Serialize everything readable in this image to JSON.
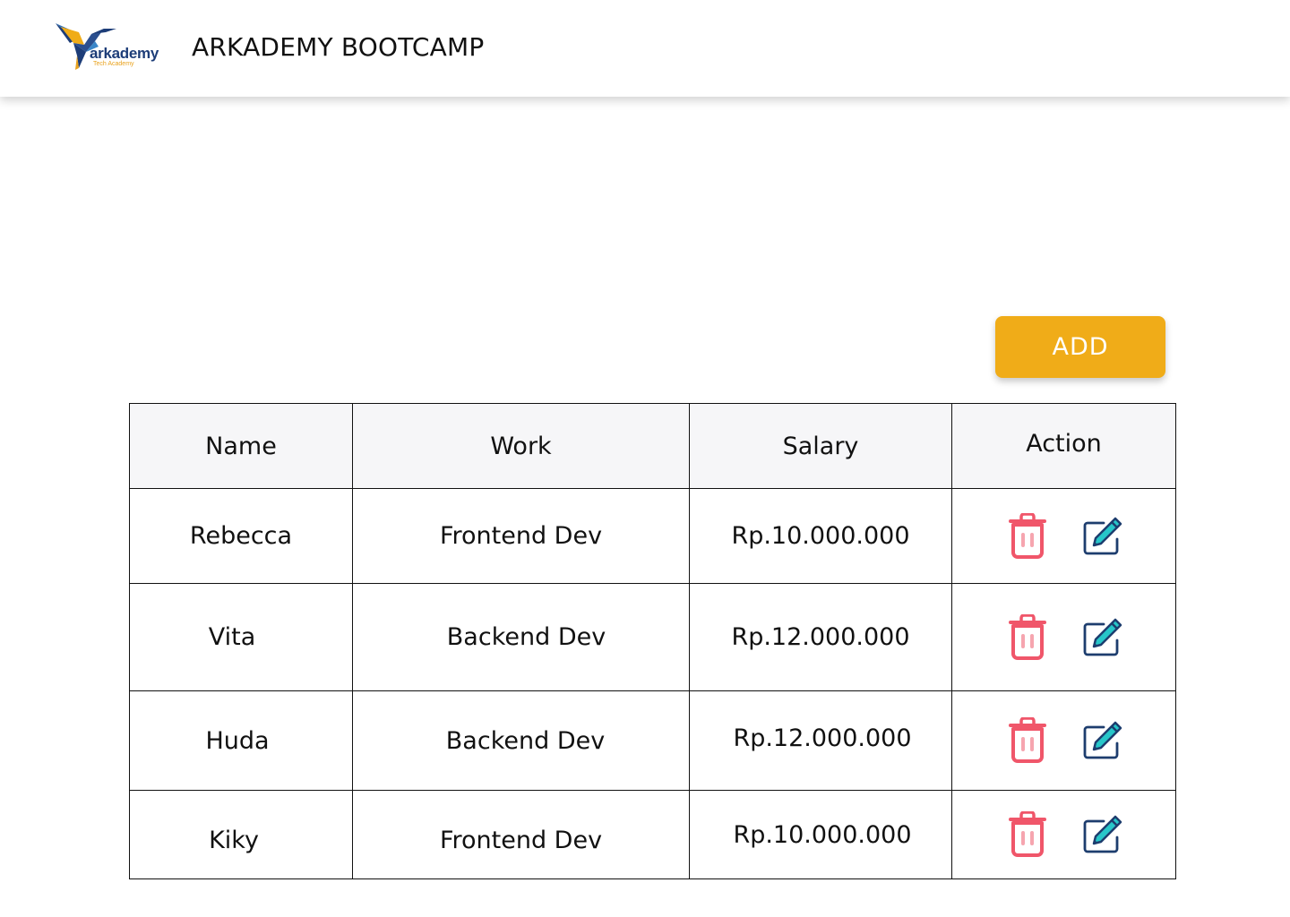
{
  "header": {
    "logo": {
      "icon": "hummingbird-logo-icon",
      "word": "arkademy",
      "sub": "Tech Academy"
    },
    "title": "ARKADEMY BOOTCAMP"
  },
  "toolbar": {
    "add_label": "ADD"
  },
  "table": {
    "headers": {
      "name": "Name",
      "work": "Work",
      "salary": "Salary",
      "action": "Action"
    },
    "rows": [
      {
        "name": "Rebecca",
        "work": "Frontend Dev",
        "salary": "Rp.10.000.000"
      },
      {
        "name": "Vita",
        "work": "Backend Dev",
        "salary": "Rp.12.000.000"
      },
      {
        "name": "Huda",
        "work": "Backend Dev",
        "salary": "Rp.12.000.000"
      },
      {
        "name": "Kiky",
        "work": "Frontend Dev",
        "salary": "Rp.10.000.000"
      }
    ],
    "actions": {
      "delete_icon": "trash-icon",
      "edit_icon": "edit-icon"
    }
  },
  "colors": {
    "accent": "#f0ac18",
    "delete": "#f0566a",
    "edit_frame": "#1d3d6e",
    "edit_pencil": "#27c6c9",
    "header_bg": "#f6f6f8"
  }
}
